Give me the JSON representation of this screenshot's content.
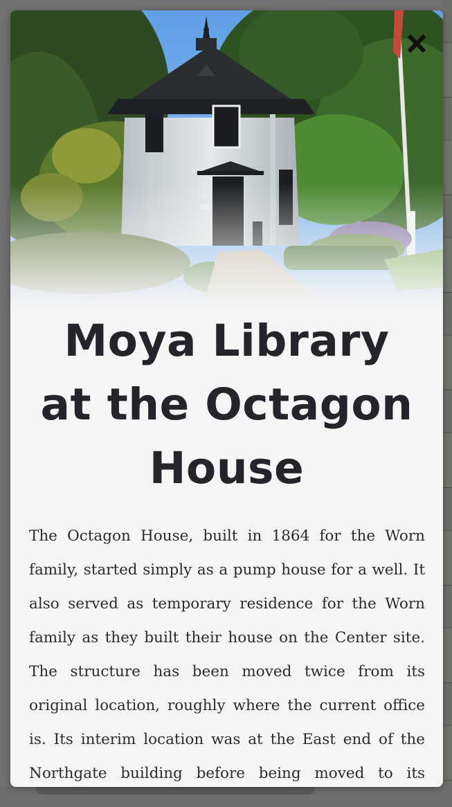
{
  "modal": {
    "title": "Moya Library at the Octagon House",
    "body": "The Octagon House, built in 1864 for the Worn family, started simply as a pump house for a well. It also served as temporary residence for the Worn family as they built their house on the Center site. The structure has been moved twice from its original location, roughly where the current office is. Its interim location was at the East end of the Northgate building before being moved to its current location.",
    "close_icon": "close-icon"
  },
  "hero": {
    "image_subject": "octagon-house-photo"
  },
  "colors": {
    "title": "#23252a",
    "text": "#2b2b2b",
    "panel": "#f5f5f5",
    "overlay": "#727272"
  }
}
